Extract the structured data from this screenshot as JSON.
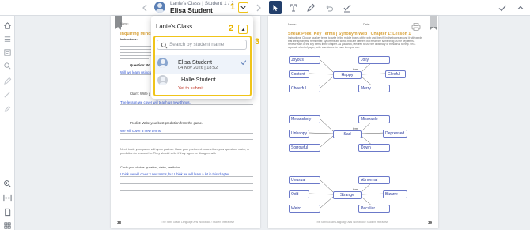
{
  "toolbar": {
    "class_label": "Lanie's Class | Student 1 / 2",
    "student_name": "Elisa Student",
    "steps": [
      "1",
      "2",
      "3"
    ],
    "icons": [
      "prev-chevron-icon",
      "next-chevron-icon",
      "cursor-icon",
      "text-select-icon",
      "pencil-icon",
      "undo-icon",
      "grade-icon",
      "checkmark-icon",
      "collapse-chevron-icon"
    ],
    "accent": "#f0c419",
    "active_tool_bg": "#223f6b"
  },
  "rail": {
    "icons": [
      "home-icon",
      "list-icon",
      "review-icon",
      "search-icon",
      "edit-icon",
      "pen-icon",
      "highlighter-icon",
      "zoom-in-icon",
      "fit-width-icon",
      "page-icon",
      "grid-icon"
    ]
  },
  "student_panel": {
    "title": "Lanie's Class",
    "search_placeholder": "Search by student name",
    "students": [
      {
        "name": "Elisa Student",
        "detail": "04 Nov 2026 | 18:52",
        "selected": true
      },
      {
        "name": "Halle Student",
        "detail": "Yet to submit",
        "selected": false
      }
    ]
  },
  "left_page": {
    "name_label": "Name:",
    "heading": "Inquiring Minds",
    "instructions_label": "Instructions:",
    "question_label": "Question: W",
    "claim_label": "Claim: Write y",
    "predict_label": "Predict: Write your best prediction from the game.",
    "next_text": "Next, trade your paper with your partner. Have your partner choose either your question, claim, or prediction to respond to. They should write if they agree or disagree with",
    "circle_text": "Circle your choice: question, claim, prediction",
    "answers": {
      "question": "Will we learn using a game",
      "claim": "The lesson we cover will teach us new things.",
      "prediction": "We will cover 3 new terms.",
      "response": "I think we will cover 3 new terms, but I think we will learn a lot in this chapter"
    },
    "page_number": "38",
    "footer": "The Sixth Grade Language Arts Workbook / Student Interactive"
  },
  "right_page": {
    "name_label": "Name:",
    "date_label": "Date:",
    "heading": "Sneak Peek: Key Terms | Synonym Web | Chapter 1: Lesson 1",
    "instructions": "Instructions: Choose four key terms to write in the middle boxes of the web and then fill in the boxes around it with words that are synonyms. Remember, synonyms are words that are different but mean the same thing as the key terms. Review each of the key terms in the chapter. As you work, feel free to use the dictionary or thesaurus to help. On a separate sheet of paper, write a sentence for each term you use.",
    "synonym_label": "term",
    "webs": [
      {
        "hub": "Happy",
        "words": [
          "Joyous",
          "Jolly",
          "Content",
          "Gleeful",
          "Cheerful",
          "Merry"
        ]
      },
      {
        "hub": "Sad",
        "words": [
          "Melancholy",
          "Miserable",
          "Unhappy",
          "Depressed",
          "Sorrowful",
          "Down"
        ]
      },
      {
        "hub": "Strange",
        "words": [
          "Unusual",
          "Abnormal",
          "Odd",
          "Bizarre",
          "Weird",
          "Peculiar"
        ]
      }
    ],
    "page_number": "39",
    "footer": "The Sixth Grade Language Arts Workbook / Student Interactive"
  }
}
